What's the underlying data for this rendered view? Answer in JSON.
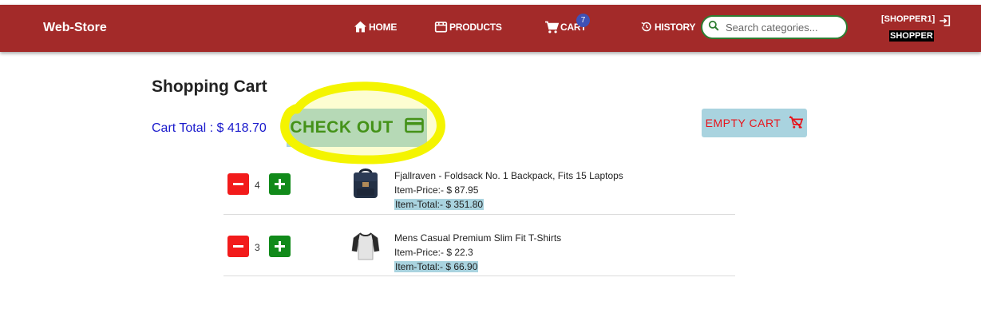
{
  "navbar": {
    "brand": "Web-Store",
    "home": "HOME",
    "products": "PRODUCTS",
    "cart": "CART",
    "cart_count": "7",
    "history": "HISTORY",
    "search_placeholder": "Search categories...",
    "user": "[SHOPPER1]",
    "role": "SHOPPER"
  },
  "page": {
    "title": "Shopping Cart",
    "cart_total": "Cart Total : $ 418.70",
    "checkout_label": "CHECK OUT",
    "empty_cart_label": "EMPTY CART"
  },
  "items": [
    {
      "qty": "4",
      "name": "Fjallraven - Foldsack No. 1 Backpack, Fits 15 Laptops",
      "price": "Item-Price:- $ 87.95",
      "total": "Item-Total:- $ 351.80",
      "thumb": "backpack"
    },
    {
      "qty": "3",
      "name": "Mens Casual Premium Slim Fit T-Shirts",
      "price": "Item-Price:- $ 22.3",
      "total": "Item-Total:- $ 66.90",
      "thumb": "tshirt"
    }
  ],
  "colors": {
    "navbar": "#a32a29",
    "highlight": "#f4f400",
    "checkout_bg": "#a9d3df",
    "checkout_text": "#1e7d1e",
    "empty_text": "#e8141b"
  }
}
